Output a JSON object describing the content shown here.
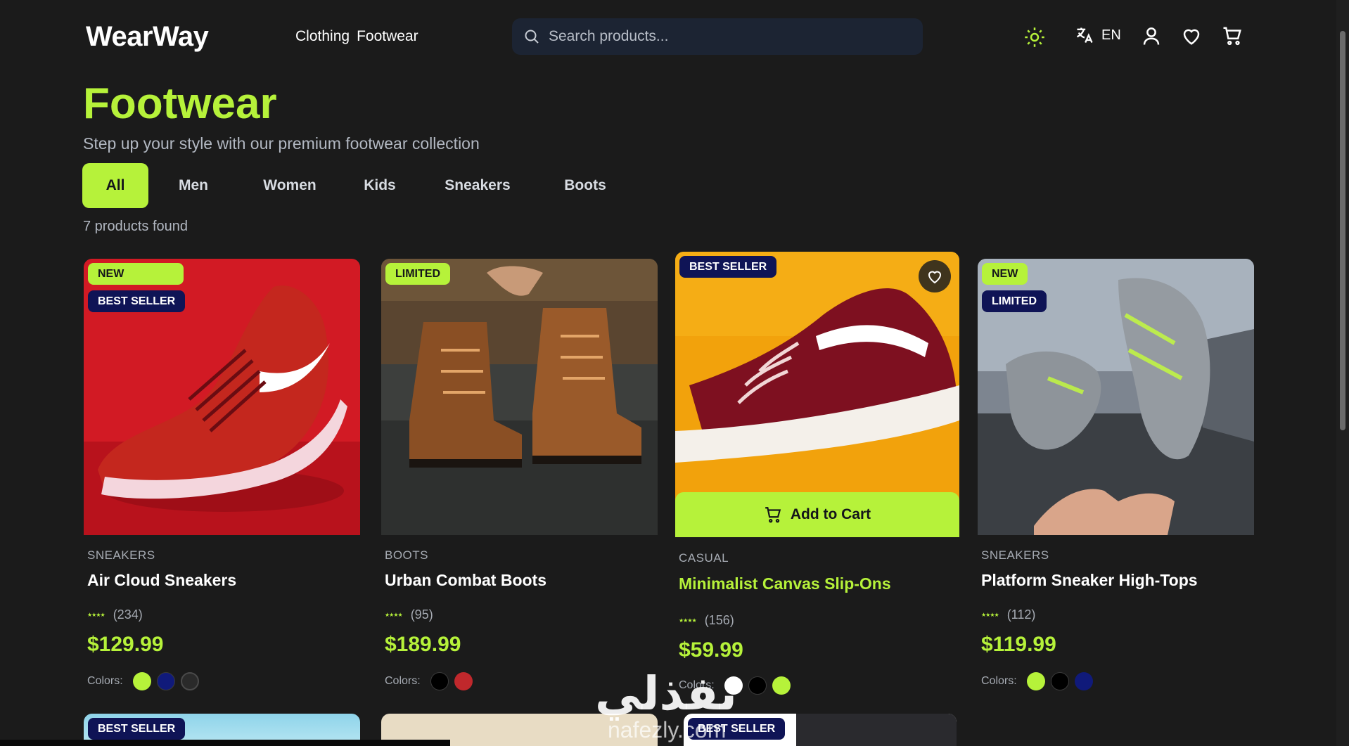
{
  "brand": "WearWay",
  "nav": [
    "Clothing",
    "Footwear"
  ],
  "search": {
    "placeholder": "Search products..."
  },
  "header_icons": [
    "sun-icon",
    "translate-icon",
    "user-icon",
    "heart-icon",
    "cart-icon"
  ],
  "language": "EN",
  "page": {
    "title": "Footwear",
    "subtitle": "Step up your style with our premium footwear collection",
    "count": "7 products found"
  },
  "filters": [
    {
      "label": "All",
      "active": true
    },
    {
      "label": "Men"
    },
    {
      "label": "Women"
    },
    {
      "label": "Kids"
    },
    {
      "label": "Sneakers"
    },
    {
      "label": "Boots"
    }
  ],
  "products": [
    {
      "category": "SNEAKERS",
      "name": "Air Cloud Sneakers",
      "reviews": "(234)",
      "price": "$129.99",
      "badges": [
        "NEW",
        "BEST SELLER"
      ],
      "colors_label": "Colors:",
      "colors": [
        "#b6f23a",
        "#101a7a",
        "#2a2a2a"
      ]
    },
    {
      "category": "BOOTS",
      "name": "Urban Combat Boots",
      "reviews": "(95)",
      "price": "$189.99",
      "badges": [
        "LIMITED"
      ],
      "colors_label": "Colors:",
      "colors": [
        "#000000",
        "#c0282c"
      ]
    },
    {
      "category": "CASUAL",
      "name": "Minimalist Canvas Slip-Ons",
      "reviews": "(156)",
      "price": "$59.99",
      "badges": [
        "BEST SELLER"
      ],
      "colors_label": "Colors:",
      "colors": [
        "#ffffff",
        "#000000",
        "#b6f23a"
      ],
      "add_to_cart": "Add to Cart"
    },
    {
      "category": "SNEAKERS",
      "name": "Platform Sneaker High-Tops",
      "reviews": "(112)",
      "price": "$119.99",
      "badges": [
        "NEW",
        "LIMITED"
      ],
      "colors_label": "Colors:",
      "colors": [
        "#b6f23a",
        "#000000",
        "#101a7a"
      ]
    }
  ],
  "next_row_badges": [
    "BEST SELLER",
    "BEST SELLER"
  ],
  "watermark": {
    "arabic": "نفذلي",
    "latin": "nafezly.com"
  },
  "colors": {
    "accent": "#b6f23a",
    "background": "#1b1b1b",
    "badge_dark": "#0f1456"
  }
}
